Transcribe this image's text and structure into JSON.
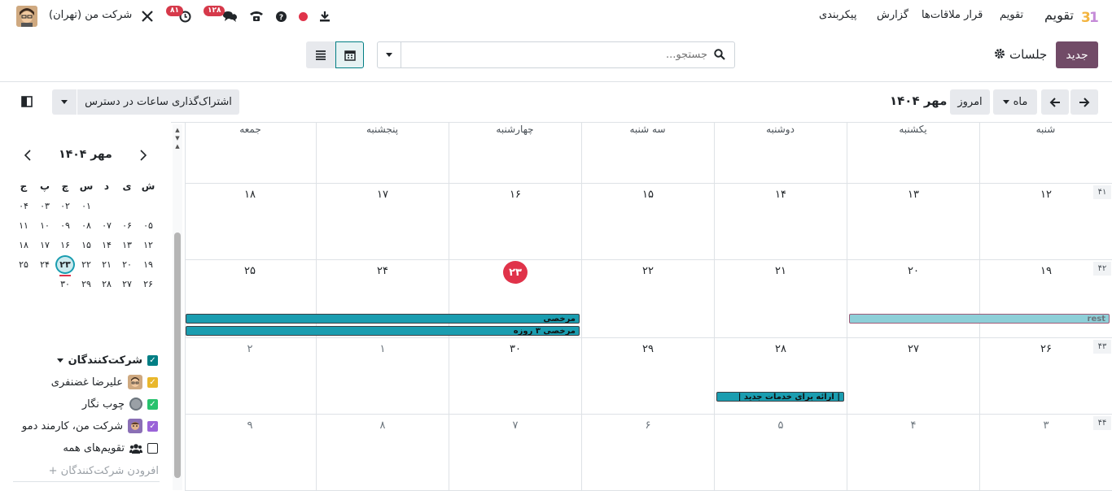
{
  "topnav": {
    "app_name": "تقویم",
    "menus": [
      "تقویم",
      "قرار ملاقات‌ها",
      "گزارش",
      "پیکربندی"
    ],
    "company": "شرکت من (تهران)",
    "activity_badge": "۸۱",
    "messages_badge": "۱۲۸"
  },
  "control": {
    "new_label": "جدید",
    "breadcrumb": "جلسات",
    "search_placeholder": "جستجو...",
    "today_label": "امروز",
    "scale_label": "ماه",
    "period_title": "مهر ۱۴۰۴",
    "share_label": "اشتراک‌گذاری ساعات در دسترس"
  },
  "weekdays": [
    "شنبه",
    "یکشنبه",
    "دوشنبه",
    "سه شنبه",
    "چهارشنبه",
    "پنجشنبه",
    "جمعه"
  ],
  "weeks": [
    {
      "week": "",
      "days": [
        "",
        "",
        "",
        "",
        "",
        "",
        ""
      ]
    },
    {
      "week": "۴۱",
      "days": [
        "۱۲",
        "۱۳",
        "۱۴",
        "۱۵",
        "۱۶",
        "۱۷",
        "۱۸"
      ]
    },
    {
      "week": "۴۲",
      "days": [
        "۱۹",
        "۲۰",
        "۲۱",
        "۲۲",
        "۲۳",
        "۲۴",
        "۲۵"
      ]
    },
    {
      "week": "۴۳",
      "days": [
        "۲۶",
        "۲۷",
        "۲۸",
        "۲۹",
        "۳۰",
        "۱",
        "۲"
      ]
    },
    {
      "week": "۴۴",
      "days": [
        "۳",
        "۴",
        "۵",
        "۶",
        "۷",
        "۸",
        "۹"
      ]
    }
  ],
  "events": {
    "rest": "rest",
    "leave": "مرخصی",
    "leave3": "مرخصی ۳ روزه",
    "service": "| ارائه برای خدمات جدید |"
  },
  "minical": {
    "title": "مهر ۱۴۰۴",
    "headers": [
      "ش",
      "ی",
      "د",
      "س",
      "چ",
      "پ",
      "ج"
    ],
    "rows": [
      [
        "",
        "",
        "",
        "",
        "۰۱",
        "۰۲",
        "۰۳",
        "۰۴"
      ],
      [
        "۰۵",
        "۰۶",
        "۰۷",
        "۰۸",
        "۰۹",
        "۱۰",
        "۱۱"
      ],
      [
        "۱۲",
        "۱۳",
        "۱۴",
        "۱۵",
        "۱۶",
        "۱۷",
        "۱۸"
      ],
      [
        "۱۹",
        "۲۰",
        "۲۱",
        "۲۲",
        "۲۳",
        "۲۴",
        "۲۵"
      ],
      [
        "۲۶",
        "۲۷",
        "۲۸",
        "۲۹",
        "۳۰",
        "",
        ""
      ]
    ],
    "today": "۲۳"
  },
  "attendees": {
    "heading": "شرکت‌کنندگان",
    "items": [
      "علیرضا غضنفری",
      "چوب نگار",
      "شرکت من، کارمند دمو",
      "تقویم‌های همه"
    ],
    "add_label": "+ افرودن شرکت‌کنندگان"
  },
  "colors": {
    "primary": "#714b67",
    "event_teal": "#1a9db0",
    "event_light": "#8ecfd8",
    "today_red": "#e0334a"
  }
}
